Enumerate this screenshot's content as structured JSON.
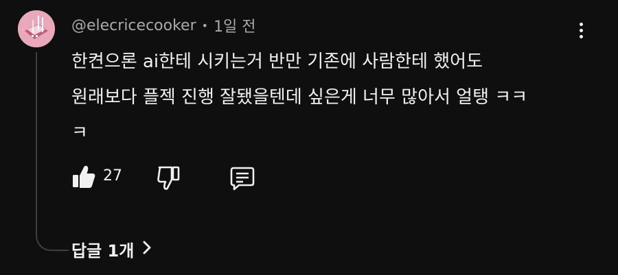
{
  "comment": {
    "author": "@elecricecooker",
    "separator": "•",
    "timestamp": "1일 전",
    "text_lines": [
      "한켠으론 ai한테 시키는거 반만 기존에 사람한테 했어도",
      "원래보다 플젝 진행 잘됐을텐데 싶은게 너무 많아서 얼탱 ㅋㅋ",
      "ㅋ"
    ],
    "like_count": "27",
    "icons": {
      "like": "thumbs-up-icon",
      "dislike": "thumbs-down-icon",
      "reply": "comment-icon",
      "menu": "more-vert-icon",
      "expand": "chevron-right-icon"
    }
  },
  "replies": {
    "toggle_label": "답글 1개",
    "chevron": "›"
  },
  "colors": {
    "background": "#0f0f0f",
    "text_primary": "#f1f1f1",
    "text_secondary": "#aaaaaa",
    "thread_line": "#3f3f3f",
    "avatar_bg": "#e9a9bb"
  }
}
